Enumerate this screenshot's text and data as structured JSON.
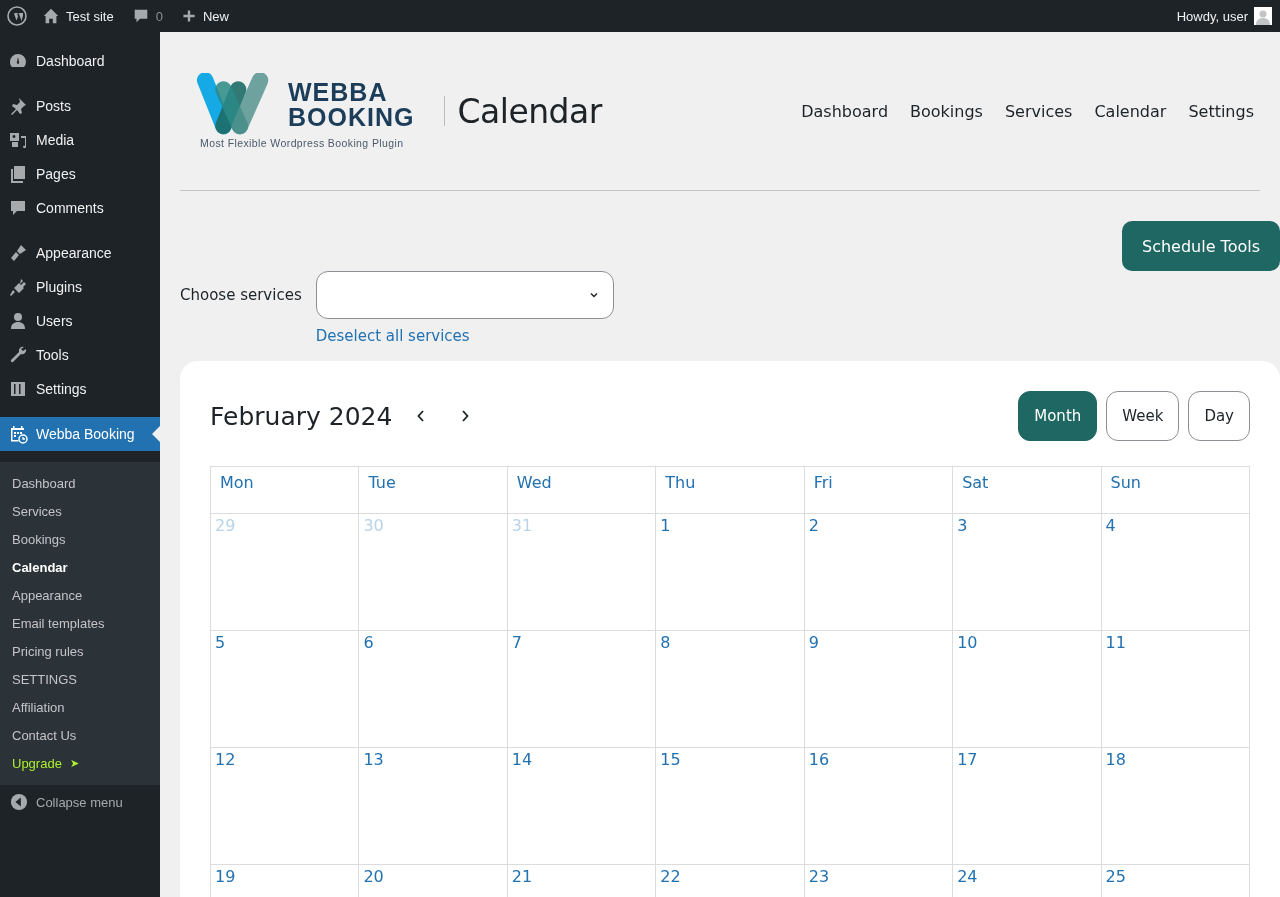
{
  "admin_bar": {
    "site": "Test site",
    "comments": "0",
    "new": "New",
    "greeting": "Howdy, user"
  },
  "sidebar": {
    "groups": [
      {
        "items": [
          {
            "label": "Dashboard",
            "selected": false
          }
        ]
      },
      {
        "items": [
          {
            "label": "Posts",
            "selected": false
          },
          {
            "label": "Media",
            "selected": false
          },
          {
            "label": "Pages",
            "selected": false
          },
          {
            "label": "Comments",
            "selected": false
          }
        ]
      },
      {
        "items": [
          {
            "label": "Appearance",
            "selected": false
          },
          {
            "label": "Plugins",
            "selected": false
          },
          {
            "label": "Users",
            "selected": false
          },
          {
            "label": "Tools",
            "selected": false
          },
          {
            "label": "Settings",
            "selected": false
          }
        ]
      },
      {
        "items": [
          {
            "label": "Webba Booking",
            "selected": true
          }
        ]
      }
    ],
    "submenu": [
      {
        "label": "Dashboard",
        "selected": false,
        "kind": "link"
      },
      {
        "label": "Services",
        "selected": false,
        "kind": "link"
      },
      {
        "label": "Bookings",
        "selected": false,
        "kind": "link"
      },
      {
        "label": "Calendar",
        "selected": true,
        "kind": "link"
      },
      {
        "label": "Appearance",
        "selected": false,
        "kind": "link"
      },
      {
        "label": "Email templates",
        "selected": false,
        "kind": "link"
      },
      {
        "label": "Pricing rules",
        "selected": false,
        "kind": "link"
      },
      {
        "label": "SETTINGS",
        "selected": false,
        "kind": "link"
      },
      {
        "label": "Affiliation",
        "selected": false,
        "kind": "link"
      },
      {
        "label": "Contact Us",
        "selected": false,
        "kind": "link"
      },
      {
        "label": "Upgrade",
        "selected": false,
        "kind": "upgrade",
        "arrow": "➤"
      }
    ],
    "collapse": "Collapse menu"
  },
  "header": {
    "logo_line1": "WEBBA",
    "logo_line2": "BOOKING",
    "tagline": "Most Flexible Wordpress Booking Plugin",
    "page_title": "Calendar",
    "nav": [
      {
        "label": "Dashboard"
      },
      {
        "label": "Bookings"
      },
      {
        "label": "Services"
      },
      {
        "label": "Calendar"
      },
      {
        "label": "Settings"
      }
    ]
  },
  "schedule_tools": "Schedule Tools",
  "services_filter": {
    "label": "Choose services",
    "deselect": "Deselect all services"
  },
  "calendar": {
    "title": "February 2024",
    "views": [
      {
        "label": "Month",
        "selected": true
      },
      {
        "label": "Week",
        "selected": false
      },
      {
        "label": "Day",
        "selected": false
      }
    ],
    "weekdays": [
      "Mon",
      "Tue",
      "Wed",
      "Thu",
      "Fri",
      "Sat",
      "Sun"
    ],
    "weeks": [
      [
        {
          "day": "29",
          "muted": true
        },
        {
          "day": "30",
          "muted": true
        },
        {
          "day": "31",
          "muted": true
        },
        {
          "day": "1",
          "muted": false
        },
        {
          "day": "2",
          "muted": false
        },
        {
          "day": "3",
          "muted": false
        },
        {
          "day": "4",
          "muted": false
        }
      ],
      [
        {
          "day": "5",
          "muted": false
        },
        {
          "day": "6",
          "muted": false
        },
        {
          "day": "7",
          "muted": false
        },
        {
          "day": "8",
          "muted": false
        },
        {
          "day": "9",
          "muted": false
        },
        {
          "day": "10",
          "muted": false
        },
        {
          "day": "11",
          "muted": false
        }
      ],
      [
        {
          "day": "12",
          "muted": false
        },
        {
          "day": "13",
          "muted": false
        },
        {
          "day": "14",
          "muted": false
        },
        {
          "day": "15",
          "muted": false
        },
        {
          "day": "16",
          "muted": false
        },
        {
          "day": "17",
          "muted": false
        },
        {
          "day": "18",
          "muted": false
        }
      ],
      [
        {
          "day": "19",
          "muted": false
        },
        {
          "day": "20",
          "muted": false
        },
        {
          "day": "21",
          "muted": false
        },
        {
          "day": "22",
          "muted": false
        },
        {
          "day": "23",
          "muted": false
        },
        {
          "day": "24",
          "muted": false
        },
        {
          "day": "25",
          "muted": false
        }
      ]
    ]
  }
}
